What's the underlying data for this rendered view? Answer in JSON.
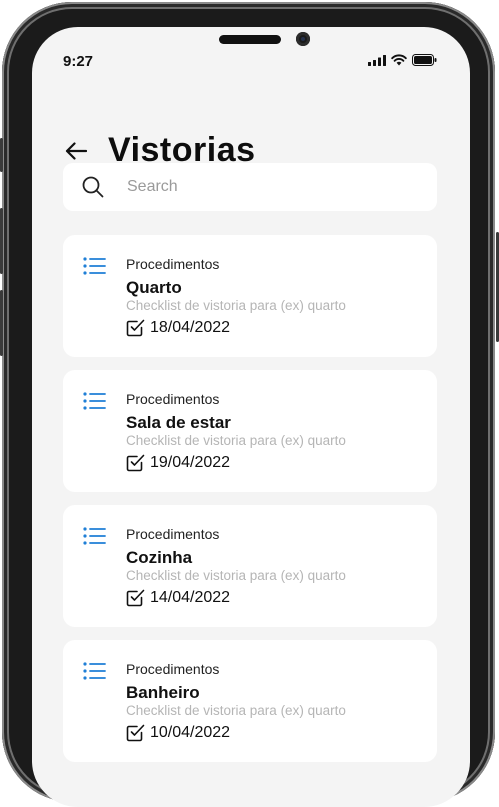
{
  "status_bar": {
    "time": "9:27"
  },
  "header": {
    "title": "Vistorias"
  },
  "search": {
    "placeholder": "Search"
  },
  "colors": {
    "accent": "#1f7fd6",
    "background": "#f4f4f4",
    "card": "#ffffff"
  },
  "cards": [
    {
      "category": "Procedimentos",
      "name": "Quarto",
      "description": "Checklist de vistoria para (ex) quarto",
      "date": "18/04/2022"
    },
    {
      "category": "Procedimentos",
      "name": "Sala de estar",
      "description": "Checklist de vistoria para (ex) quarto",
      "date": "19/04/2022"
    },
    {
      "category": "Procedimentos",
      "name": "Cozinha",
      "description": "Checklist de vistoria para (ex) quarto",
      "date": "14/04/2022"
    },
    {
      "category": "Procedimentos",
      "name": "Banheiro",
      "description": "Checklist de vistoria para (ex) quarto",
      "date": "10/04/2022"
    }
  ]
}
